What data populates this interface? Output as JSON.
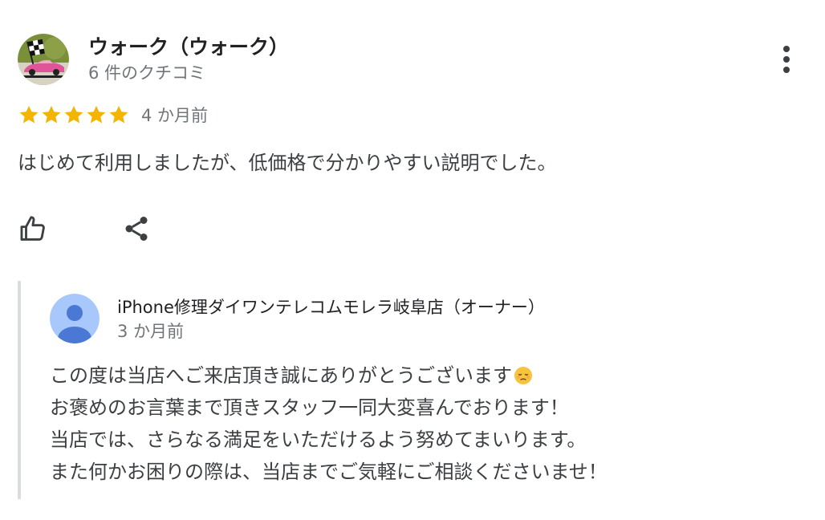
{
  "review": {
    "reviewer_name": "ウォーク（ウォーク）",
    "review_count": "6 件のクチコミ",
    "rating": 5,
    "rating_max": 5,
    "date": "4 か月前",
    "text": "はじめて利用しましたが、低価格で分かりやすい説明でした。",
    "avatar_icon": "race-car-checkered-flag-avatar",
    "more_icon": "more-vert-icon",
    "like_icon": "thumb-up-icon",
    "share_icon": "share-icon",
    "star_color": "#f4b400"
  },
  "owner_response": {
    "name": "iPhone修理ダイワンテレコムモレラ岐阜店（オーナー）",
    "date": "3 か月前",
    "avatar_icon": "default-person-avatar",
    "avatar_color": "#a8c7fa",
    "lines": [
      "この度は当店へご来店頂き誠にありがとうございます",
      "お褒めのお言葉まで頂きスタッフ一同大変喜んでおります！",
      "当店では、さらなる満足をいただけるよう努めてまいります。",
      "また何かお困りの際は、当店までご気軽にご相談くださいませ！"
    ],
    "emoji_icon": "pensive-face-emoji"
  }
}
